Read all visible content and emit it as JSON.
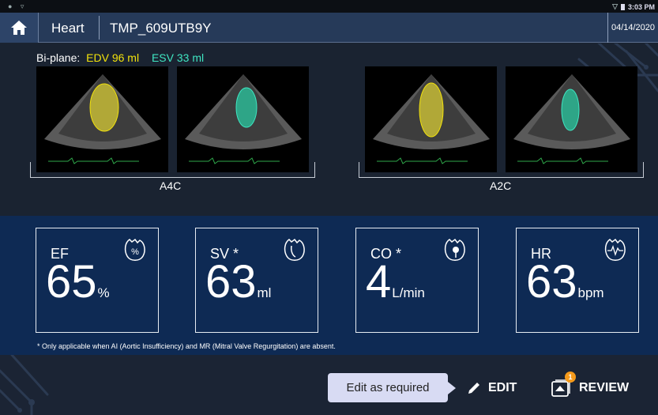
{
  "status_bar": {
    "time": "3:03 PM"
  },
  "header": {
    "exam": "Heart",
    "patient_id": "TMP_609UTB9Y",
    "date": "04/14/2020"
  },
  "biplane": {
    "label": "Bi-plane:",
    "edv": "EDV 96 ml",
    "esv": "ESV 33 ml"
  },
  "views": [
    {
      "label": "A4C"
    },
    {
      "label": "A2C"
    }
  ],
  "metrics": [
    {
      "label": "EF",
      "value": "65",
      "unit": "%",
      "icon": "heart-percent-icon"
    },
    {
      "label": "SV *",
      "value": "63",
      "unit": "ml",
      "icon": "heart-volume-icon"
    },
    {
      "label": "CO *",
      "value": "4",
      "unit": "L/min",
      "icon": "heart-output-icon"
    },
    {
      "label": "HR",
      "value": "63",
      "unit": "bpm",
      "icon": "heart-rate-icon"
    }
  ],
  "footnote": "* Only applicable when AI (Aortic Insufficiency) and MR (Mitral Valve Regurgitation) are absent.",
  "actions": {
    "tooltip": "Edit as required",
    "edit_label": "EDIT",
    "review_label": "REVIEW",
    "review_badge": "1"
  },
  "colors": {
    "edv": "#f2e20b",
    "esv": "#3fe6c2",
    "panel": "#0e2a54",
    "header": "#263a59"
  }
}
